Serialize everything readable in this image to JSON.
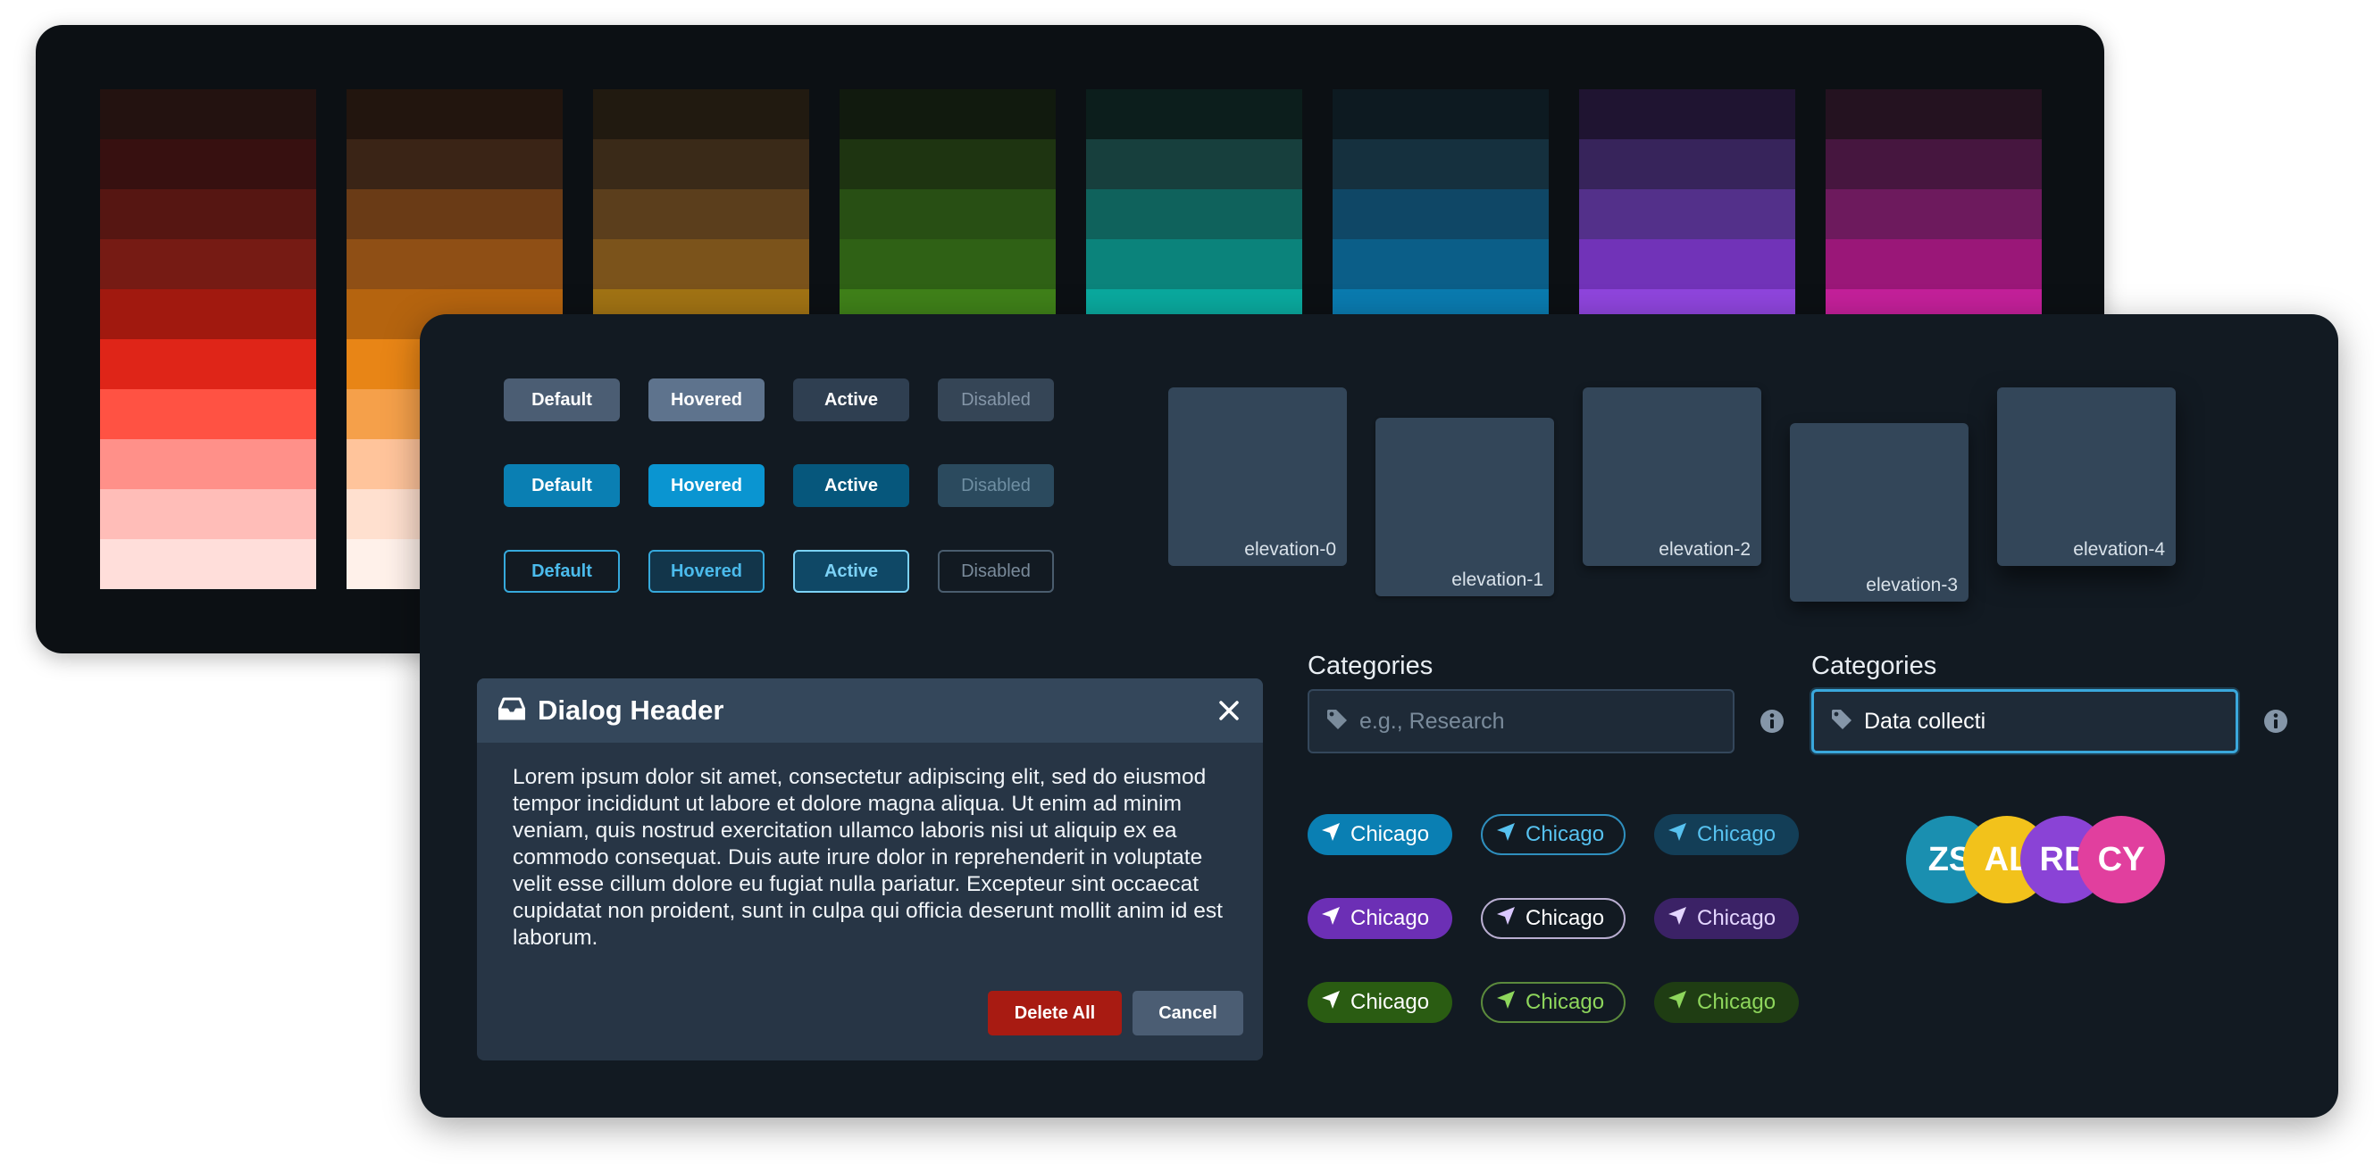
{
  "palette": {
    "columns": [
      {
        "name": "red",
        "colors": [
          "#231210",
          "#371010",
          "#561612",
          "#761b14",
          "#a1190f",
          "#df2518",
          "#ff5243",
          "#ff9089",
          "#ffbdb8",
          "#ffdeda"
        ]
      },
      {
        "name": "orange",
        "colors": [
          "#22150e",
          "#3a2416",
          "#6a3b16",
          "#8f4f15",
          "#b5640f",
          "#e88516",
          "#f5a04a",
          "#ffc49b",
          "#ffe0cf",
          "#fff1ea"
        ]
      },
      {
        "name": "amber",
        "colors": [
          "#211a10",
          "#3a2a18",
          "#5b3e1c",
          "#7b531b",
          "#a17314"
        ]
      },
      {
        "name": "green",
        "colors": [
          "#111a0e",
          "#1e3411",
          "#284f14",
          "#2f6115",
          "#3f8119"
        ]
      },
      {
        "name": "teal",
        "colors": [
          "#0c1e1c",
          "#173f3d",
          "#0f625c",
          "#0b837b",
          "#0aa99e"
        ]
      },
      {
        "name": "blue",
        "colors": [
          "#0d1a21",
          "#15303e",
          "#0f4766",
          "#0b5e88",
          "#0a7bb0"
        ]
      },
      {
        "name": "purple",
        "colors": [
          "#1f1431",
          "#37245b",
          "#53308a",
          "#7133b8",
          "#8f45dd"
        ]
      },
      {
        "name": "pink",
        "colors": [
          "#241220",
          "#46163f",
          "#6d1a5d",
          "#9a1778",
          "#c4209a"
        ]
      }
    ]
  },
  "buttons": {
    "default": "Default",
    "hovered": "Hovered",
    "active": "Active",
    "disabled": "Disabled"
  },
  "elevations": [
    "elevation-0",
    "elevation-1",
    "elevation-2",
    "elevation-3",
    "elevation-4"
  ],
  "dialog": {
    "title": "Dialog Header",
    "body": "Lorem ipsum dolor sit amet, consectetur adipiscing elit, sed do eiusmod tempor incididunt ut labore et dolore magna aliqua. Ut enim ad minim veniam, quis nostrud exercitation ullamco laboris nisi ut aliquip ex ea commodo consequat. Duis aute irure dolor in reprehenderit in voluptate velit esse cillum dolore eu fugiat nulla pariatur. Excepteur sint occaecat cupidatat non proident, sunt in culpa qui officia deserunt mollit anim id est laborum.",
    "delete_label": "Delete All",
    "cancel_label": "Cancel"
  },
  "categories": {
    "label": "Categories",
    "placeholder": "e.g., Research",
    "value": "Data collecti"
  },
  "tags": {
    "label": "Chicago"
  },
  "avatars": [
    {
      "initials": "ZS",
      "color": "#1a8fb0"
    },
    {
      "initials": "AL",
      "color": "#f2c21b"
    },
    {
      "initials": "RD",
      "color": "#8a43d6"
    },
    {
      "initials": "CY",
      "color": "#e13f9e"
    }
  ]
}
